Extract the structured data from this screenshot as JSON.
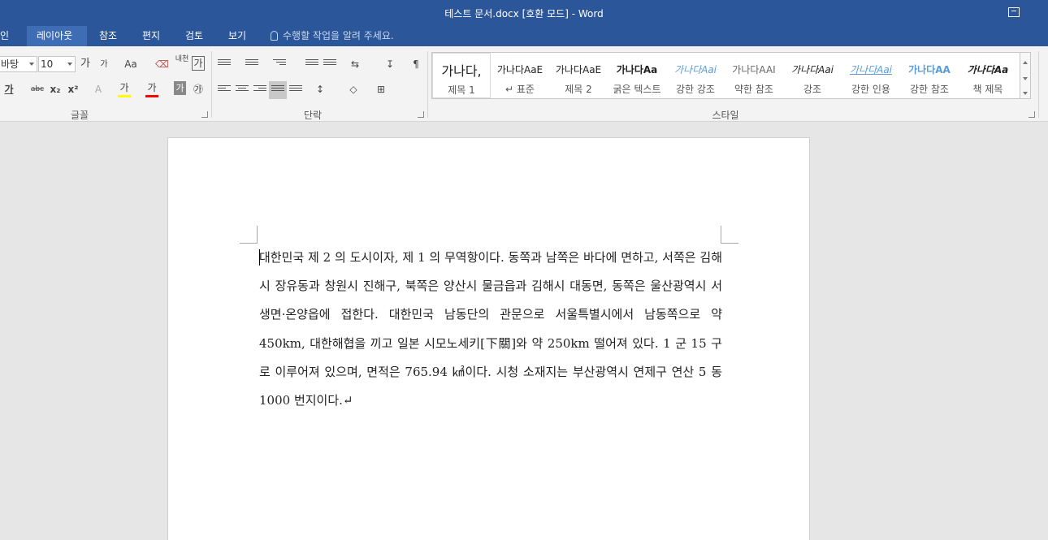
{
  "window": {
    "title": "테스트 문서.docx [호환 모드] - Word"
  },
  "tabs": [
    {
      "label": "인"
    },
    {
      "label": "레이아웃"
    },
    {
      "label": "참조"
    },
    {
      "label": "편지"
    },
    {
      "label": "검토"
    },
    {
      "label": "보기"
    }
  ],
  "tell_me": {
    "placeholder": "수행할 작업을 알려 주세요."
  },
  "font_group": {
    "font_name": "바탕",
    "font_size": "10",
    "grow": "가",
    "shrink": "가",
    "change_case": "Aa",
    "phonetic": "내천",
    "enclose": "가",
    "bold": "가",
    "strike": "abc",
    "subscript": "x₂",
    "superscript": "x²",
    "highlight": "가",
    "font_color": "가",
    "shade": "가",
    "circle": "㉮",
    "label": "글꼴"
  },
  "paragraph_group": {
    "label": "단락"
  },
  "styles_group": {
    "label": "스타일",
    "items": [
      {
        "preview": "가나다,",
        "name": "제목 1"
      },
      {
        "preview": "가나다AaE",
        "name": "↵ 표준"
      },
      {
        "preview": "가나다AaE",
        "name": "제목 2"
      },
      {
        "preview": "가나다Aa",
        "name": "굵은 텍스트"
      },
      {
        "preview": "가나다Aai",
        "name": "강한 강조"
      },
      {
        "preview": "가나다AAI",
        "name": "약한 참조"
      },
      {
        "preview": "가나다Aai",
        "name": "강조"
      },
      {
        "preview": "가나다Aai",
        "name": "강한 인용"
      },
      {
        "preview": "가나다AA",
        "name": "강한 참조"
      },
      {
        "preview": "가나다Aa",
        "name": "책 제목"
      }
    ]
  },
  "document": {
    "paragraph": "대한민국 제 2 의 도시이자, 제 1 의 무역항이다. 동쪽과 남쪽은 바다에 면하고, 서쪽은 김해시 장유동과 창원시 진해구, 북쪽은 양산시 물금읍과 김해시 대동면, 동쪽은 울산광역시 서생면·온양읍에 접한다. 대한민국 남동단의 관문으로 서울특별시에서 남동쪽으로 약 450km, 대한해협을 끼고 일본 시모노세키[下關]와 약 250km 떨어져 있다. 1 군 15 구로 이루어져 있으며, 면적은 765.94 ㎢이다. 시청 소재지는 부산광역시 연제구 연산 5 동 1000 번지이다.↵"
  },
  "colors": {
    "accent": "#2b579a",
    "highlight": "#ffff00",
    "font_color": "#ff0000"
  }
}
